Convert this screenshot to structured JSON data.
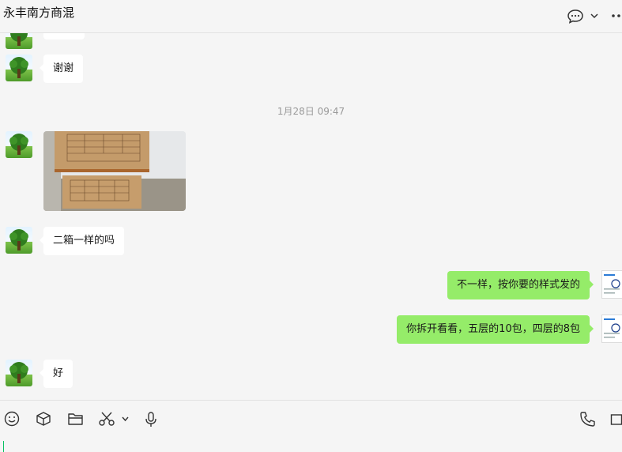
{
  "header": {
    "title": "永丰南方商混"
  },
  "messages": [
    {
      "id": "m1",
      "side": "in",
      "type": "text",
      "text": "谢谢"
    },
    {
      "id": "ts",
      "type": "timestamp",
      "text": "1月28日 09:47"
    },
    {
      "id": "m2",
      "side": "in",
      "type": "image",
      "icon": "box-photo"
    },
    {
      "id": "m3",
      "side": "in",
      "type": "text",
      "text": "二箱一样的吗"
    },
    {
      "id": "m4",
      "side": "out",
      "type": "text",
      "text": "不一样，按你要的样式发的"
    },
    {
      "id": "m5",
      "side": "out",
      "type": "text",
      "text": "你拆开看看，五层的10包，四层的8包"
    },
    {
      "id": "m6",
      "side": "in",
      "type": "text",
      "text": "好"
    }
  ],
  "toolbar": {
    "left_icons": [
      "emoji-icon",
      "box-icon",
      "folder-icon",
      "scissors-icon",
      "chevron-down-icon",
      "microphone-icon"
    ],
    "right_icons": [
      "phone-icon",
      "video-icon"
    ]
  },
  "colors": {
    "outgoing_bubble": "#95ec69",
    "incoming_bubble": "#ffffff",
    "background": "#f5f5f5"
  }
}
